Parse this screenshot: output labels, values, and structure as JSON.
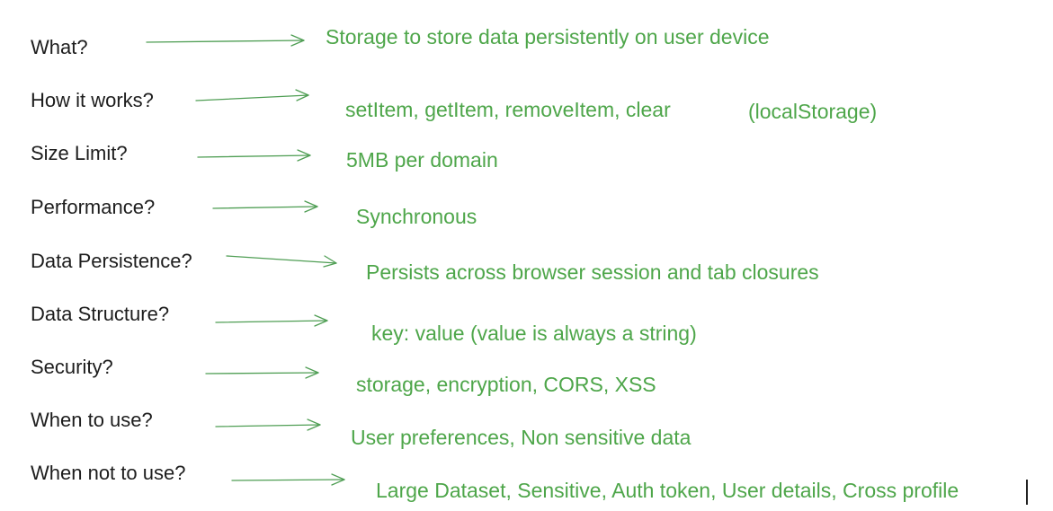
{
  "rows": [
    {
      "question": "What?",
      "answer": "Storage to store data persistently on user device"
    },
    {
      "question": "How it works?",
      "answer": "setItem, getItem, removeItem, clear",
      "note": "(localStorage)"
    },
    {
      "question": "Size Limit?",
      "answer": "5MB per domain"
    },
    {
      "question": "Performance?",
      "answer": "Synchronous"
    },
    {
      "question": "Data Persistence?",
      "answer": "Persists across browser session and tab closures"
    },
    {
      "question": "Data Structure?",
      "answer": "key: value (value is always a string)"
    },
    {
      "question": "Security?",
      "answer": "storage, encryption, CORS, XSS"
    },
    {
      "question": "When to use?",
      "answer": "User preferences, Non sensitive data"
    },
    {
      "question": "When not to use?",
      "answer": "Large Dataset, Sensitive, Auth token, User details, Cross profile"
    }
  ],
  "colors": {
    "question_text": "#1d1d1d",
    "answer_text": "#4ea64a",
    "arrow": "#4f9e54",
    "background": "#ffffff"
  }
}
